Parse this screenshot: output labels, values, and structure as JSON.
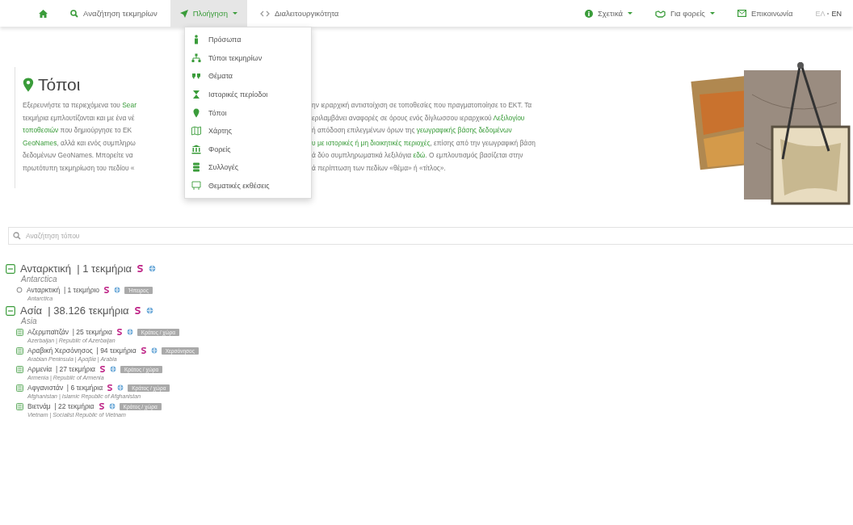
{
  "nav": {
    "left": [
      {
        "label": "Αναζήτηση τεκμηρίων",
        "selected": false,
        "menu": false
      },
      {
        "label": "Πλοήγηση",
        "selected": true,
        "menu": true
      },
      {
        "label": "Διαλειτουργικότητα",
        "selected": false,
        "menu": false
      }
    ],
    "right": [
      {
        "label": "Σχετικά",
        "menu": true
      },
      {
        "label": "Για φορείς",
        "menu": true
      },
      {
        "label": "Επικοινωνία",
        "menu": false
      }
    ],
    "languages": [
      {
        "label": "ΕΛ",
        "selected": true
      },
      {
        "label": "EN",
        "selected": false
      }
    ]
  },
  "dropdown": [
    "Πρόσωπα",
    "Τύποι τεκμηρίων",
    "Θέματα",
    "Ιστορικές περίοδοι",
    "Τόποι",
    "Χάρτης",
    "Φορείς",
    "Συλλογές",
    "Θεματικές εκθέσεις"
  ],
  "title": "Τόποι",
  "intro": [
    {
      "left": [
        {
          "t": "Εξερευνήστε τα περιεχόμενα του "
        },
        {
          "t": "Sear",
          "link": true
        }
      ],
      "right": [
        {
          "t": "ην ιεραρχική αντιστοίχιση σε τοποθεσίες που πραγματοποίησε το ΕΚΤ. Τα"
        }
      ]
    },
    {
      "left": [
        {
          "t": "τεκμήρια εμπλουτίζονται και με ένα νέ"
        }
      ],
      "right": [
        {
          "t": "εριλαμβάνει αναφορές σε όρους ενός δίγλωσσου ιεραρχικού "
        },
        {
          "t": "Λεξιλογίου",
          "link": true
        }
      ]
    },
    {
      "left": [
        {
          "t": "τοποθεσιών",
          "link": true
        },
        {
          "t": " που δημιούργησε το ΕΚ"
        }
      ],
      "right": [
        {
          "t": "ή απόδοση επιλεγμένων όρων της "
        },
        {
          "t": "γεωγραφικής βάσης δεδομένων",
          "link": true
        }
      ]
    },
    {
      "left": [
        {
          "t": "GeoNames",
          "link": true
        },
        {
          "t": ", αλλά και ενός συμπληρω"
        }
      ],
      "right": [
        {
          "t": "υ με ιστορικές ή μη διοικητικές περιοχές",
          "link": true
        },
        {
          "t": ", επίσης από την γεωγραφική βάση"
        }
      ]
    },
    {
      "left": [
        {
          "t": "δεδομένων GeoNames. Μπορείτε να"
        }
      ],
      "right": [
        {
          "t": "ά δύο συμπληρωματικά λεξιλόγια "
        },
        {
          "t": "εδώ",
          "link": true
        },
        {
          "t": ". Ο εμπλουτισμός βασίζεται στην"
        }
      ]
    },
    {
      "left": [
        {
          "t": "πρωτότυπη τεκμηρίωση του πεδίου «"
        }
      ],
      "right": [
        {
          "t": "ά περίπτωση των πεδίων «θέμα» ή «τίτλος»."
        }
      ]
    }
  ],
  "search": {
    "placeholder": "Αναζήτηση τόπου"
  },
  "tree": [
    {
      "kind": "branch",
      "expanded": true,
      "name": "Ανταρκτική",
      "count": "| 1 τεκμήρια",
      "subtitle": "Antarctica",
      "children": [
        {
          "kind": "leaf",
          "name": "Ανταρκτική",
          "count": "| 1 τεκμήριο",
          "subtitle": "Antarctica",
          "badge": "Ήπειρος"
        }
      ]
    },
    {
      "kind": "branch",
      "expanded": true,
      "name": "Ασία",
      "count": "| 38.126 τεκμήρια",
      "subtitle": "Asia",
      "children": [
        {
          "kind": "branch",
          "expanded": false,
          "name": "Αζερμπαϊτζάν",
          "count": "| 25 τεκμήρια",
          "subtitle": "Azerbaijan | Republic of Azerbaijan",
          "badge": "Κράτος / χώρα"
        },
        {
          "kind": "branch",
          "expanded": false,
          "name": "Αραβική Χερσόνησος",
          "count": "| 94 τεκμήρια",
          "subtitle": "Arabian Peninsula | Αραβία | Arabia",
          "badge": "Χερσόνησος"
        },
        {
          "kind": "branch",
          "expanded": false,
          "name": "Αρμενία",
          "count": "| 27 τεκμήρια",
          "subtitle": "Armenia | Republic of Armenia",
          "badge": "Κράτος / χώρα"
        },
        {
          "kind": "branch",
          "expanded": false,
          "name": "Αφγανιστάν",
          "count": "| 6 τεκμήρια",
          "subtitle": "Afghanistan | Islamic Republic of Afghanistan",
          "badge": "Κράτος / χώρα"
        },
        {
          "kind": "branch",
          "expanded": false,
          "name": "Βιετνάμ",
          "count": "| 22 τεκμήρια",
          "subtitle": "Vietnam | Socialist Republic of Vietnam",
          "badge": "Κράτος / χώρα"
        }
      ]
    }
  ]
}
